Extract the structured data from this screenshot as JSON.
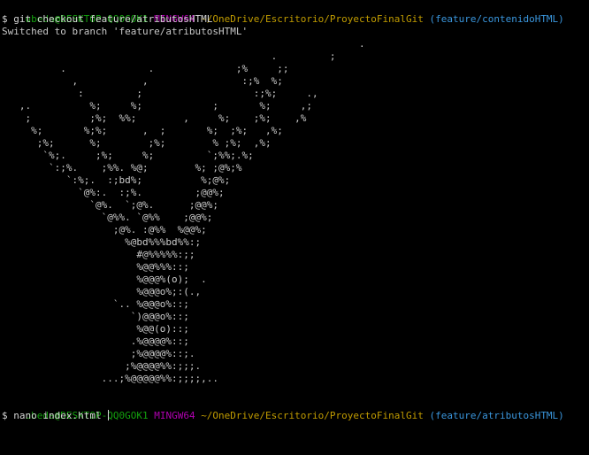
{
  "colors": {
    "background": "#000000",
    "user_host": "#13a10e",
    "system": "#b000b0",
    "path": "#c19c00",
    "branch": "#3a96dd",
    "text": "#d6d6d6"
  },
  "prompt1": {
    "user_host": "ubeda@DESKTOP-QQ0GOK1",
    "system": "MINGW64",
    "path": "~/OneDrive/Escritorio/ProyectoFinalGit",
    "branch": "(feature/contenidoHTML)"
  },
  "command1": "$ git checkout feature/atributosHTML",
  "output1": "Switched to branch 'feature/atributosHTML'",
  "ascii_art": "                                                             .\n                                              .         ;\n          .              .              ;%     ;;\n            ,           ,                :;%  %;\n             :         ;                   :;%;     .,\n   ,.          %;     %;            ;       %;     ,;\n    ;          ;%;  %%;        ,     %;    ;%;    ,%\n     %;       %;%;      ,  ;       %;  ;%;   ,%;\n      ;%;      %;        ;%;        % ;%;  ,%;\n       `%;.     ;%;     %;         `;%%;.%;\n        `:;%.    ;%%. %@;        %; ;@%;%\n           `:%;.  :;bd%;          %;@%;\n             `@%:.  :;%.         ;@@%;\n               `@%.  `;@%.      ;@@%;\n                 `@%%. `@%%    ;@@%;\n                   ;@%. :@%%  %@@%;\n                     %@bd%%%bd%%:;\n                       #@%%%%%:;;\n                       %@@%%%::;\n                       %@@@%(o);  .\n                       %@@@o%;:(.,\n                   `.. %@@@o%::;\n                      `)@@@o%::;\n                       %@@(o)::;\n                      .%@@@@%::;\n                      ;%@@@@%::;.\n                     ;%@@@@%%:;;;.\n                 ...;%@@@@@%%:;;;;,..",
  "prompt2": {
    "user_host": "ubeda@DESKTOP-QQ0GOK1",
    "system": "MINGW64",
    "path": "~/OneDrive/Escritorio/ProyectoFinalGit",
    "branch": "(feature/atributosHTML)"
  },
  "command2": "$ nano index.html "
}
